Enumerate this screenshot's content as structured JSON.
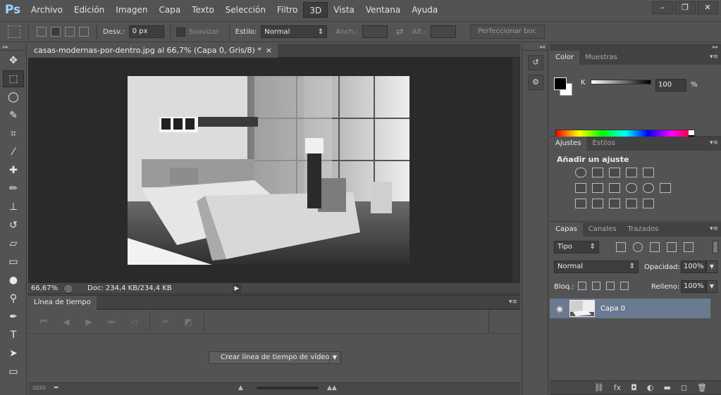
{
  "menu": {
    "logo": "Ps",
    "items": [
      "Archivo",
      "Edición",
      "Imagen",
      "Capa",
      "Texto",
      "Selección",
      "Filtro",
      "3D",
      "Vista",
      "Ventana",
      "Ayuda"
    ],
    "active_item": "3D",
    "win_minimize": "–",
    "win_restore": "❐",
    "win_close": "✕"
  },
  "options": {
    "desv_label": "Desv.:",
    "desv_value": "0 px",
    "suavizar_label": "Suavizar",
    "estilo_label": "Estilo:",
    "estilo_value": "Normal",
    "anch_label": "Anch.:",
    "alt_label": "Alt.:",
    "refine_button": "Perfeccionar bor."
  },
  "document": {
    "tab_title": "casas-modernas-por-dentro.jpg al 66,7% (Capa 0, Gris/8) *",
    "close_glyph": "×",
    "zoom": "66,67%",
    "doc_size": "Doc: 234,4 KB/234,4 KB"
  },
  "timeline": {
    "tab": "Línea de tiempo",
    "create_button": "Crear línea de tiempo de vídeo"
  },
  "color_panel": {
    "tabs": [
      "Color",
      "Muestras"
    ],
    "channel_label": "K",
    "channel_value": "100",
    "unit": "%"
  },
  "adjust_panel": {
    "tabs": [
      "Ajustes",
      "Estilos"
    ],
    "title": "Añadir un ajuste"
  },
  "layers_panel": {
    "tabs": [
      "Capas",
      "Canales",
      "Trazados"
    ],
    "filter_kind": "Tipo",
    "blend_mode": "Normal",
    "opacity_label": "Opacidad:",
    "opacity_value": "100%",
    "lock_label": "Bloq.:",
    "fill_label": "Relleno:",
    "fill_value": "100%",
    "layers": [
      {
        "name": "Capa 0"
      }
    ]
  },
  "icons": {
    "tools": [
      "move-icon",
      "marquee-icon",
      "lasso-icon",
      "quick-select-icon",
      "crop-icon",
      "eyedropper-icon",
      "healing-icon",
      "brush-icon",
      "stamp-icon",
      "history-brush-icon",
      "eraser-icon",
      "gradient-icon",
      "blur-icon",
      "dodge-icon",
      "pen-icon",
      "type-icon",
      "path-select-icon",
      "rectangle-icon"
    ]
  },
  "colors": {
    "accent_layer_selected": "#6a7a90",
    "ps_logo": "#9fd3ff"
  }
}
